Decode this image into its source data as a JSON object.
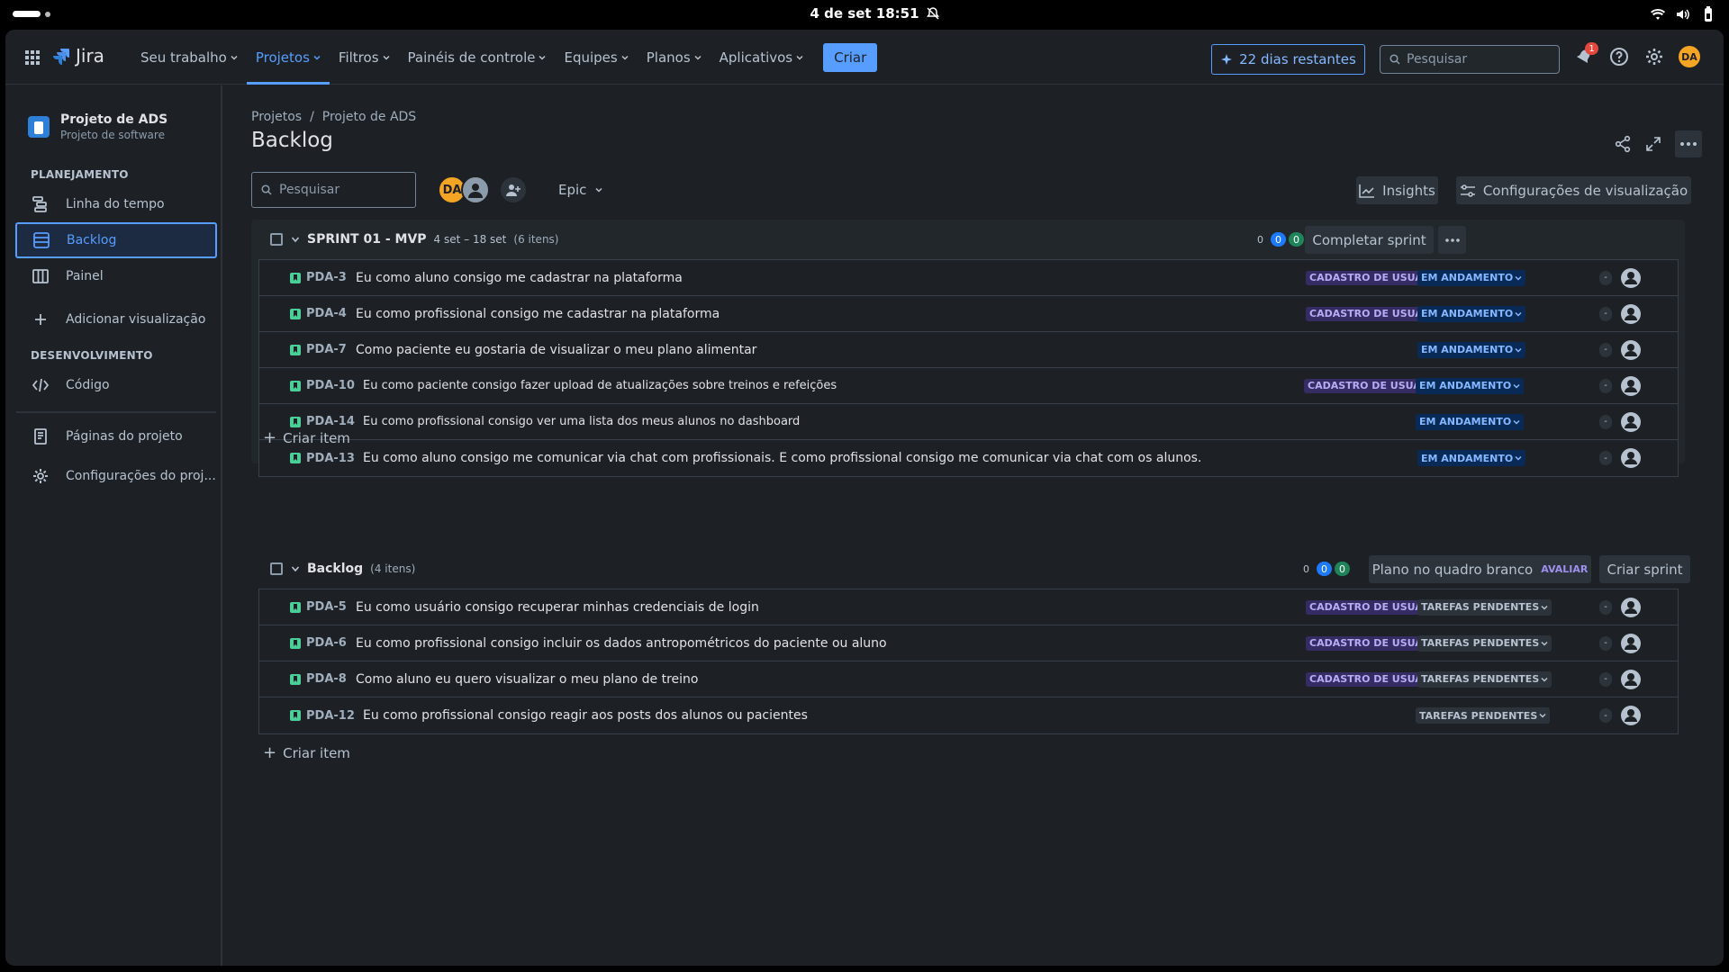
{
  "system": {
    "clock": "4 de set  18:51"
  },
  "topnav": {
    "logo": "Jira",
    "menu": [
      {
        "label": "Seu trabalho",
        "active": false
      },
      {
        "label": "Projetos",
        "active": true
      },
      {
        "label": "Filtros",
        "active": false
      },
      {
        "label": "Painéis de controle",
        "active": false
      },
      {
        "label": "Equipes",
        "active": false
      },
      {
        "label": "Planos",
        "active": false
      },
      {
        "label": "Aplicativos",
        "active": false
      }
    ],
    "create_label": "Criar",
    "trial_label": "22 dias restantes",
    "search_placeholder": "Pesquisar",
    "notification_count": "1",
    "avatar_initials": "DA"
  },
  "sidebar": {
    "project_name": "Projeto de ADS",
    "project_type": "Projeto de software",
    "section_planning": "PLANEJAMENTO",
    "section_dev": "DESENVOLVIMENTO",
    "items": {
      "timeline": "Linha do tempo",
      "backlog": "Backlog",
      "board": "Painel",
      "add_view": "Adicionar visualização",
      "code": "Código",
      "pages": "Páginas do projeto",
      "settings": "Configurações do proj..."
    }
  },
  "main": {
    "breadcrumb": [
      "Projetos",
      "/",
      "Projeto de ADS"
    ],
    "title": "Backlog",
    "search_placeholder": "Pesquisar",
    "avatar_initials": "DA",
    "epic_filter": "Epic",
    "insights_label": "Insights",
    "view_settings_label": "Configurações de visualização",
    "create_item_label": "Criar item"
  },
  "sprint": {
    "title": "SPRINT 01 - MVP",
    "dates": "4 set – 18 set",
    "count": "(6 itens)",
    "counts": {
      "todo": "0",
      "in_progress": "0",
      "done": "0"
    },
    "complete_label": "Completar sprint",
    "issues": [
      {
        "key": "PDA-3",
        "summary": "Eu como aluno consigo me cadastrar na plataforma",
        "epic": "CADASTRO DE USUÁRIO",
        "status": "EM ANDAMENTO",
        "estimate": "-"
      },
      {
        "key": "PDA-4",
        "summary": "Eu como profissional consigo me cadastrar na plataforma",
        "epic": "CADASTRO DE USUÁRIO",
        "status": "EM ANDAMENTO",
        "estimate": "-"
      },
      {
        "key": "PDA-7",
        "summary": "Como paciente eu gostaria de visualizar o meu plano alimentar",
        "epic": "",
        "status": "EM ANDAMENTO",
        "estimate": "-"
      },
      {
        "key": "PDA-10",
        "summary": "Eu como paciente consigo fazer upload de atualizações sobre treinos e refeições",
        "epic": "CADASTRO DE USUÁRIO",
        "status": "EM ANDAMENTO",
        "estimate": "-"
      },
      {
        "key": "PDA-14",
        "summary": "Eu como profissional consigo ver uma lista dos meus alunos no dashboard",
        "epic": "",
        "status": "EM ANDAMENTO",
        "estimate": "-"
      },
      {
        "key": "PDA-13",
        "summary": "Eu como aluno consigo me comunicar via chat com profissionais. E como profissional consigo me comunicar via chat com os alunos.",
        "epic": "",
        "status": "EM ANDAMENTO",
        "estimate": "-"
      }
    ]
  },
  "backlog": {
    "title": "Backlog",
    "count": "(4 itens)",
    "counts": {
      "todo": "0",
      "in_progress": "0",
      "done": "0"
    },
    "whiteboard_label": "Plano no quadro branco",
    "evaluate_label": "AVALIAR",
    "create_sprint_label": "Criar sprint",
    "issues": [
      {
        "key": "PDA-5",
        "summary": "Eu como usuário consigo recuperar minhas credenciais de login",
        "epic": "CADASTRO DE USUÁRIO",
        "status": "TAREFAS PENDENTES",
        "estimate": "-"
      },
      {
        "key": "PDA-6",
        "summary": "Eu como profissional consigo incluir os dados antropométricos do paciente ou aluno",
        "epic": "CADASTRO DE USUÁRIO",
        "status": "TAREFAS PENDENTES",
        "estimate": "-"
      },
      {
        "key": "PDA-8",
        "summary": "Como aluno eu quero visualizar o meu plano de treino",
        "epic": "CADASTRO DE USUÁRIO",
        "status": "TAREFAS PENDENTES",
        "estimate": "-"
      },
      {
        "key": "PDA-12",
        "summary": "Eu como profissional consigo reagir aos posts dos alunos ou pacientes",
        "epic": "",
        "status": "TAREFAS PENDENTES",
        "estimate": "-"
      }
    ]
  },
  "colors": {
    "accent": "#579dff",
    "epic": "#b8acf6",
    "story": "#4bce97",
    "background": "#1d2125"
  }
}
